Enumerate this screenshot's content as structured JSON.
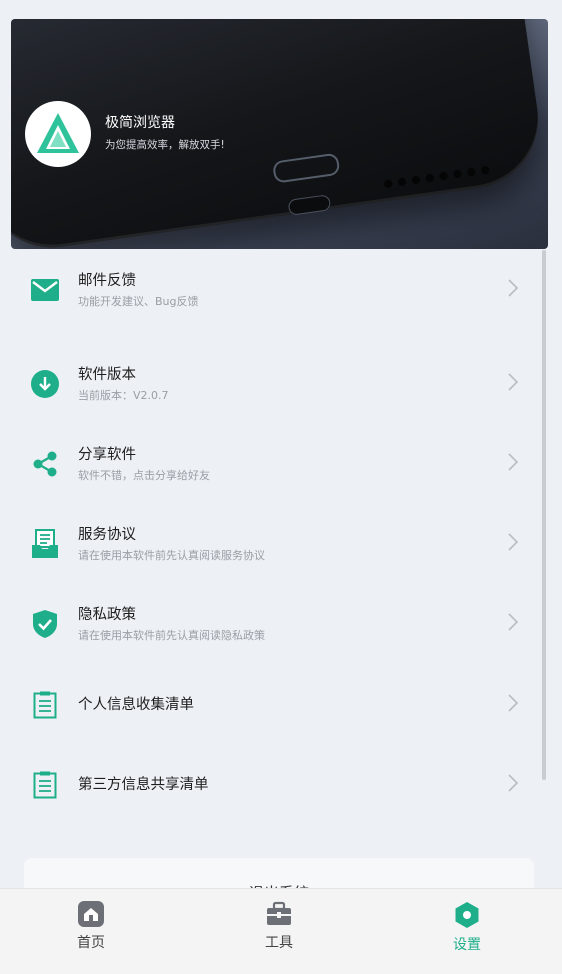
{
  "app": {
    "name": "极简浏览器",
    "slogan": "为您提高效率，解放双手!"
  },
  "colors": {
    "accent": "#1fae8a",
    "background": "#edf1f5"
  },
  "menu": [
    {
      "icon": "mail-icon",
      "title": "邮件反馈",
      "subtitle": "功能开发建议、Bug反馈"
    },
    {
      "icon": "download-icon",
      "title": "软件版本",
      "subtitle": "当前版本：V2.0.7"
    },
    {
      "icon": "share-icon",
      "title": "分享软件",
      "subtitle": "软件不错，点击分享给好友"
    },
    {
      "icon": "inbox-document-icon",
      "title": "服务协议",
      "subtitle": "请在使用本软件前先认真阅读服务协议"
    },
    {
      "icon": "shield-check-icon",
      "title": "隐私政策",
      "subtitle": "请在使用本软件前先认真阅读隐私政策"
    },
    {
      "icon": "checklist-icon",
      "title": "个人信息收集清单"
    },
    {
      "icon": "checklist-icon",
      "title": "第三方信息共享清单"
    }
  ],
  "logout_label": "退出系统",
  "tabs": [
    {
      "icon": "home-icon",
      "label": "首页"
    },
    {
      "icon": "toolbox-icon",
      "label": "工具"
    },
    {
      "icon": "settings-icon",
      "label": "设置",
      "active": true
    }
  ]
}
